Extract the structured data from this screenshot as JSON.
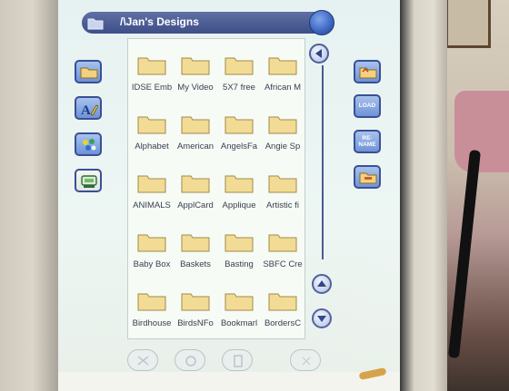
{
  "window": {
    "title": "/\\Jan's Designs"
  },
  "files": [
    {
      "label": "IDSE Emb"
    },
    {
      "label": "My Video"
    },
    {
      "label": "5X7 free"
    },
    {
      "label": "African M"
    },
    {
      "label": "Alphabet"
    },
    {
      "label": "American"
    },
    {
      "label": "AngelsFa"
    },
    {
      "label": "Angie Sp"
    },
    {
      "label": "ANIMALS"
    },
    {
      "label": "ApplCard"
    },
    {
      "label": "Applique"
    },
    {
      "label": "Artistic fi"
    },
    {
      "label": "Baby Box"
    },
    {
      "label": "Baskets"
    },
    {
      "label": "Basting"
    },
    {
      "label": "SBFC Cre"
    },
    {
      "label": "Birdhouse"
    },
    {
      "label": "BirdsNFo"
    },
    {
      "label": "Bookmarl"
    },
    {
      "label": "BordersC"
    }
  ],
  "side_buttons_right": {
    "load": "LOAD",
    "rename": "RE-\nNAME"
  },
  "icons": {
    "folder": "folder-icon",
    "back": "left-arrow-icon",
    "up": "up-arrow-icon",
    "down": "down-arrow-icon"
  },
  "colors": {
    "title_bar": "#3d4e88",
    "folder_fill": "#f2dc95",
    "button_blue": "#6f93d6",
    "screen_bg": "#e9f4f1"
  }
}
